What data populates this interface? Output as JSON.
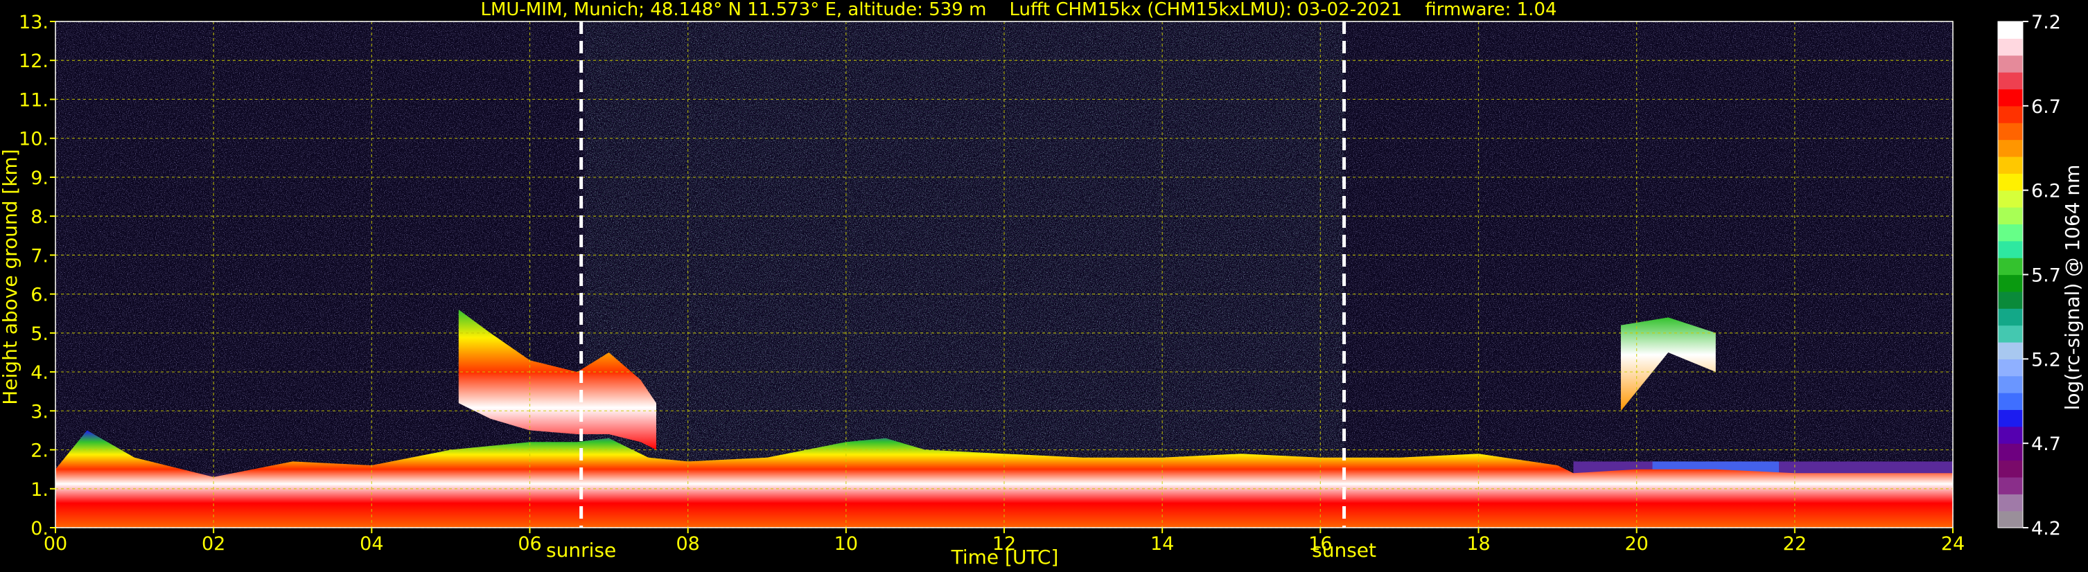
{
  "chart_data": {
    "type": "heatmap",
    "title": "LMU-MIM, Munich; 48.148° N 11.573° E, altitude: 539 m    Lufft CHM15kx (CHM15kxLMU): 03-02-2021    firmware: 1.04",
    "xlabel": "Time [UTC]",
    "ylabel": "Height above ground [km]",
    "colorbar_label": "log(rc-signal) @ 1064 nm",
    "xlim": [
      0,
      24
    ],
    "ylim": [
      0,
      13
    ],
    "x_ticks": [
      "00",
      "02",
      "04",
      "06",
      "08",
      "10",
      "12",
      "14",
      "16",
      "18",
      "20",
      "22",
      "24"
    ],
    "y_ticks": [
      "0.",
      "1.",
      "2.",
      "3.",
      "4.",
      "5.",
      "6.",
      "7.",
      "8.",
      "9.",
      "10.",
      "11.",
      "12.",
      "13."
    ],
    "grid": true,
    "colorbar": {
      "range": [
        4.2,
        7.2
      ],
      "ticks": [
        "4.2",
        "4.7",
        "5.2",
        "5.7",
        "6.2",
        "6.7",
        "7.2"
      ],
      "colors": [
        "#9a8f9a",
        "#a07aa8",
        "#8a2e8a",
        "#7a0a6a",
        "#6e0080",
        "#5500b0",
        "#1c1cf0",
        "#3f6fff",
        "#6a96ff",
        "#8fb0ff",
        "#a8c8f0",
        "#44c8b0",
        "#13a888",
        "#0a8a3a",
        "#0a9a10",
        "#34c22e",
        "#2ee8a0",
        "#66ff88",
        "#a8ff55",
        "#d6ff3a",
        "#fff000",
        "#ffc800",
        "#ff9600",
        "#ff6400",
        "#ff3200",
        "#ff0000",
        "#ee4050",
        "#e58a9a",
        "#ffd8e0",
        "#ffffff"
      ]
    },
    "annotations": [
      {
        "label": "sunrise",
        "x": 6.65
      },
      {
        "label": "sunset",
        "x": 16.3
      }
    ],
    "features": [
      {
        "kind": "boundary_layer",
        "t": [
          0,
          0.4,
          1,
          2,
          3,
          4,
          5,
          6,
          6.6,
          7,
          7.5,
          8,
          9,
          10,
          10.5,
          11,
          12,
          13,
          14,
          15,
          16,
          17,
          18,
          19,
          19.2,
          20,
          21,
          22,
          24
        ],
        "top": [
          1.5,
          2.5,
          1.8,
          1.3,
          1.7,
          1.6,
          2,
          2.2,
          2.2,
          2.3,
          1.8,
          1.7,
          1.8,
          2.2,
          2.3,
          2.0,
          1.9,
          1.8,
          1.8,
          1.9,
          1.8,
          1.8,
          1.9,
          1.6,
          1.4,
          1.5,
          1.5,
          1.4,
          1.4
        ]
      },
      {
        "kind": "aerosol_layer",
        "t": [
          5.1,
          5.5,
          6,
          6.6,
          7,
          7.4,
          7.6
        ],
        "top": [
          5.6,
          5.0,
          4.3,
          4.0,
          4.5,
          3.8,
          3.2
        ],
        "bottom": [
          3.2,
          2.8,
          2.5,
          2.4,
          2.4,
          2.2,
          2.0
        ]
      },
      {
        "kind": "cloud",
        "t": [
          19.8,
          20.4,
          21.0
        ],
        "top": [
          5.2,
          5.4,
          5.0
        ],
        "bottom": [
          3.0,
          4.5,
          4.0
        ]
      }
    ]
  }
}
